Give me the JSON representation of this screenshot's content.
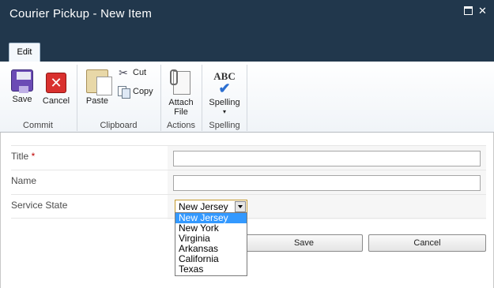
{
  "window": {
    "title": "Courier Pickup - New Item"
  },
  "ribbon": {
    "tab_label": "Edit",
    "groups": {
      "commit": {
        "label": "Commit",
        "save": "Save",
        "cancel": "Cancel"
      },
      "clipboard": {
        "label": "Clipboard",
        "paste": "Paste",
        "cut": "Cut",
        "copy": "Copy"
      },
      "actions": {
        "label": "Actions",
        "attach_line1": "Attach",
        "attach_line2": "File"
      },
      "spelling": {
        "label": "Spelling",
        "button": "Spelling",
        "icon_text": "ABC"
      }
    }
  },
  "form": {
    "fields": [
      {
        "label": "Title",
        "required_marker": "*",
        "value": ""
      },
      {
        "label": "Name",
        "value": ""
      },
      {
        "label": "Service State",
        "value": "New Jersey"
      }
    ],
    "service_state_options": [
      "New Jersey",
      "New York",
      "Virginia",
      "Arkansas",
      "California",
      "Texas"
    ],
    "selected_option": "New Jersey"
  },
  "buttons": {
    "save": "Save",
    "cancel": "Cancel"
  },
  "icons": [
    "save-icon",
    "cancel-icon",
    "paste-icon",
    "cut-icon",
    "copy-icon",
    "attach-file-icon",
    "spelling-icon",
    "maximize-icon",
    "close-icon"
  ]
}
